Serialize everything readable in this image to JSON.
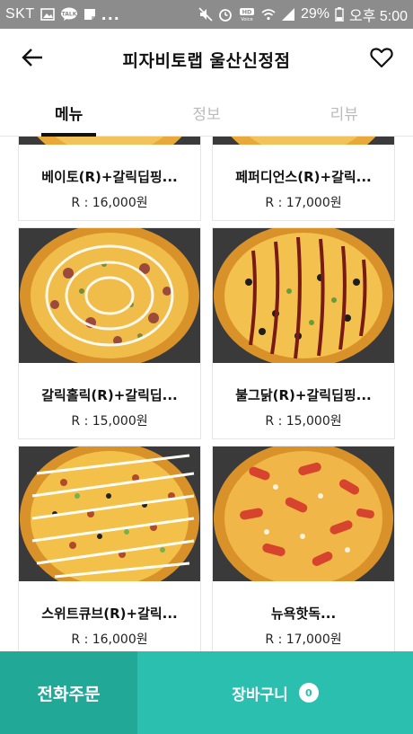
{
  "status_bar": {
    "carrier": "SKT",
    "overflow": "...",
    "battery": "29%",
    "time": "오후 5:00",
    "icons": [
      "image-icon",
      "talk-icon",
      "note-icon",
      "mute-icon",
      "alarm-icon",
      "hd-voice-icon",
      "wifi-icon",
      "signal-icon",
      "battery-icon"
    ]
  },
  "header": {
    "title": "피자비토랩 울산신정점",
    "back_icon": "arrow-left-icon",
    "favorite_icon": "heart-outline-icon"
  },
  "tabs": [
    {
      "label": "메뉴",
      "active": true
    },
    {
      "label": "정보",
      "active": false
    },
    {
      "label": "리뷰",
      "active": false
    }
  ],
  "menu_items": [
    {
      "name": "베이토(R)+갈릭딥핑...",
      "price": "R : 16,000원"
    },
    {
      "name": "페퍼디언스(R)+갈릭...",
      "price": "R : 17,000원"
    },
    {
      "name": "갈릭홀릭(R)+갈릭딥...",
      "price": "R : 15,000원"
    },
    {
      "name": "불그닭(R)+갈릭딥핑...",
      "price": "R : 15,000원"
    },
    {
      "name": "스위트큐브(R)+갈릭...",
      "price": "R : 16,000원"
    },
    {
      "name": "뉴욕핫독...",
      "price": "R : 17,000원"
    }
  ],
  "bottom_bar": {
    "phone_order_label": "전화주문",
    "cart_label": "장바구니",
    "cart_count": "0"
  },
  "colors": {
    "primary_teal": "#2bbfb0",
    "dark_teal": "#22a897",
    "status_bar": "#8c8c8c"
  }
}
